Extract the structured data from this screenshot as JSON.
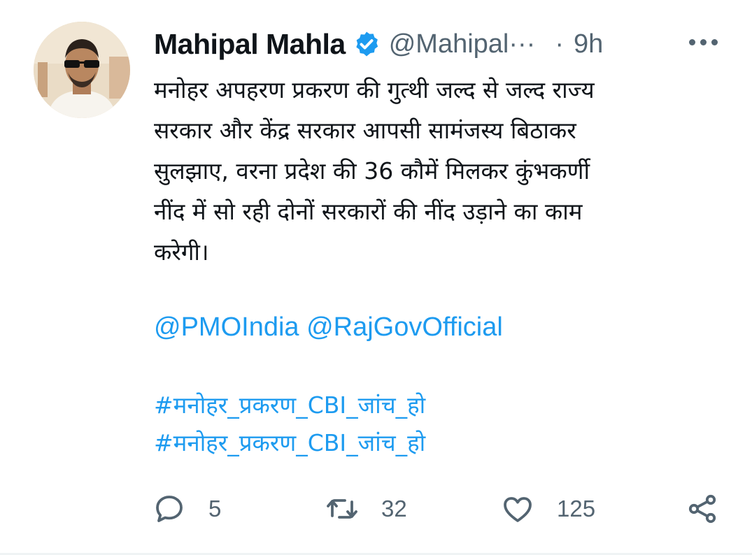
{
  "author": {
    "name": "Mahipal Mahla",
    "handle": "@Mahipal···",
    "separator": "·",
    "time": "9h",
    "verified": true
  },
  "tweet": {
    "lines": [
      "मनोहर अपहरण प्रकरण की गुत्थी जल्द से जल्द राज्य",
      "सरकार और केंद्र सरकार आपसी सामंजस्य बिठाकर",
      "सुलझाए, वरना प्रदेश की 36 कौमें मिलकर कुंभकर्णी",
      "नींद में सो रही दोनों सरकारों की नींद उड़ाने का काम",
      "करेगी।"
    ],
    "mentions": "@PMOIndia @RajGovOfficial",
    "hashtags": [
      "#मनोहर_प्रकरण_CBI_जांच_हो",
      "#मनोहर_प्रकरण_CBI_जांच_हो"
    ]
  },
  "actions": {
    "reply_count": "5",
    "retweet_count": "32",
    "like_count": "125"
  },
  "icons": {
    "reply": "reply-icon",
    "retweet": "retweet-icon",
    "like": "heart-icon",
    "share": "share-icon",
    "more": "more-icon",
    "verified": "verified-badge-icon"
  },
  "colors": {
    "text": "#0f1419",
    "secondary": "#536471",
    "link": "#1d9bf0",
    "verified": "#1d9bf0"
  }
}
